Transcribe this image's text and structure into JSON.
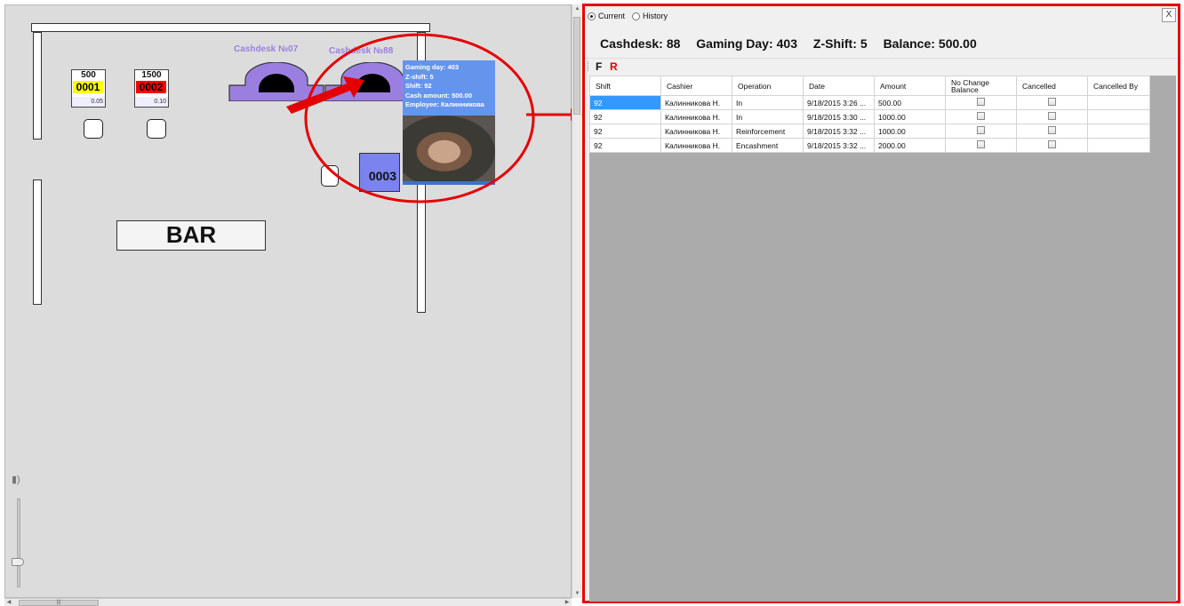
{
  "floor": {
    "cashdesks": [
      {
        "label": "Cashdesk №07"
      },
      {
        "label": "Cashdesk №88"
      }
    ],
    "slots": [
      {
        "top": "500",
        "number": "0001",
        "bottom": "0.05",
        "color": "#ffff00"
      },
      {
        "top": "1500",
        "number": "0002",
        "bottom": "0.10",
        "color": "#ff0000"
      }
    ],
    "station": {
      "number": "0003"
    },
    "bar_label": "BAR",
    "tooltip": {
      "gaming_day": "Gaming day: 403",
      "z_shift": "Z-shift: 5",
      "shift": "Shift: 92",
      "cash_amount": "Cash amount: 500.00",
      "employee": "Employee: Калинникова"
    }
  },
  "panel": {
    "radio": {
      "current": "Current",
      "history": "History",
      "selected": "current"
    },
    "close_label": "X",
    "info": {
      "cashdesk_label": "Cashdesk:",
      "cashdesk_value": "88",
      "gaming_day_label": "Gaming Day:",
      "gaming_day_value": "403",
      "zshift_label": "Z-Shift:",
      "zshift_value": "5",
      "balance_label": "Balance:",
      "balance_value": "500.00"
    },
    "toolbar": {
      "f_label": "F",
      "r_label": "R"
    },
    "table": {
      "columns": [
        "Shift",
        "Cashier",
        "Operation",
        "Date",
        "Amount",
        "No Change Balance",
        "Cancelled",
        "Cancelled By"
      ],
      "rows": [
        {
          "shift": "92",
          "cashier": "Калинникова Н.",
          "operation": "In",
          "date": "9/18/2015 3:26 ...",
          "amount": "500.00",
          "no_change_balance": false,
          "cancelled": false,
          "cancelled_by": ""
        },
        {
          "shift": "92",
          "cashier": "Калинникова Н.",
          "operation": "In",
          "date": "9/18/2015 3:30 ...",
          "amount": "1000.00",
          "no_change_balance": false,
          "cancelled": false,
          "cancelled_by": ""
        },
        {
          "shift": "92",
          "cashier": "Калинникова Н.",
          "operation": "Reinforcement",
          "date": "9/18/2015 3:32 ...",
          "amount": "1000.00",
          "no_change_balance": false,
          "cancelled": false,
          "cancelled_by": ""
        },
        {
          "shift": "92",
          "cashier": "Калинникова Н.",
          "operation": "Encashment",
          "date": "9/18/2015 3:32 ...",
          "amount": "2000.00",
          "no_change_balance": false,
          "cancelled": false,
          "cancelled_by": ""
        }
      ]
    }
  },
  "colors": {
    "highlight_red": "#e40000",
    "desk_purple": "#9b7fe0",
    "selected_cell": "#3399ff",
    "tooltip_blue": "#6495ed"
  },
  "icons": [
    "speaker-icon",
    "close-icon",
    "scroll-arrow-icon",
    "arrow-icon"
  ]
}
